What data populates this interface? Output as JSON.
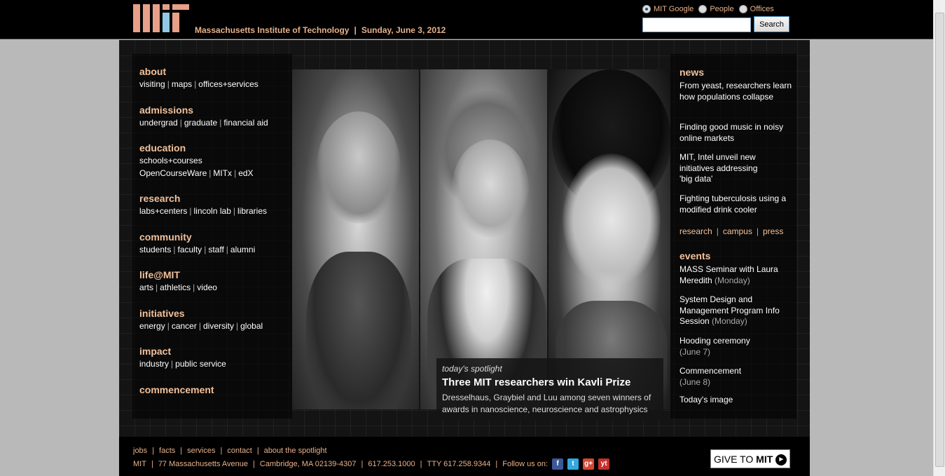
{
  "header": {
    "site_name": "Massachusetts Institute of Technology",
    "separator": "|",
    "date": "Sunday, June 3, 2012",
    "search": {
      "options": [
        "MIT Google",
        "People",
        "Offices"
      ],
      "selected": "MIT Google",
      "value": "",
      "placeholder": "",
      "button": "Search"
    }
  },
  "nav": [
    {
      "title": "about",
      "lines": [
        [
          "visiting",
          "maps",
          "offices+services"
        ]
      ]
    },
    {
      "title": "admissions",
      "lines": [
        [
          "undergrad",
          "graduate",
          "financial aid"
        ]
      ]
    },
    {
      "title": "education",
      "lines": [
        [
          "schools+courses"
        ],
        [
          "OpenCourseWare",
          "MITx",
          "edX"
        ]
      ]
    },
    {
      "title": "research",
      "lines": [
        [
          "labs+centers",
          "lincoln lab",
          "libraries"
        ]
      ]
    },
    {
      "title": "community",
      "lines": [
        [
          "students",
          "faculty",
          "staff",
          "alumni"
        ]
      ]
    },
    {
      "title": "life@MIT",
      "lines": [
        [
          "arts",
          "athletics",
          "video"
        ]
      ]
    },
    {
      "title": "initiatives",
      "lines": [
        [
          "energy",
          "cancer",
          "diversity",
          "global"
        ]
      ]
    },
    {
      "title": "impact",
      "lines": [
        [
          "industry",
          "public service"
        ]
      ]
    },
    {
      "title": "commencement",
      "lines": []
    }
  ],
  "spotlight": {
    "kicker": "today's spotlight",
    "headline": "Three MIT researchers win Kavli Prize",
    "description": "Dresselhaus, Graybiel and Luu among seven winners of awards in nanoscience, neuroscience and astrophysics"
  },
  "news": {
    "title": "news",
    "items": [
      "From yeast, researchers learn how populations collapse",
      "Finding good music in noisy online markets",
      "MIT, Intel unveil new initiatives addressing 'big data'",
      "Fighting tuberculosis using a modified drink cooler"
    ],
    "links": [
      "research",
      "campus",
      "press"
    ]
  },
  "events": {
    "title": "events",
    "items": [
      {
        "text": "MASS Seminar with Laura Meredith",
        "when": "(Monday)"
      },
      {
        "text": "System Design and Management Program Info Session",
        "when": "(Monday)"
      },
      {
        "text": "Hooding ceremony",
        "when": "(June 7)"
      },
      {
        "text": "Commencement",
        "when": "(June 8)"
      }
    ],
    "todays_image": "Today's image"
  },
  "footer": {
    "links": [
      "jobs",
      "facts",
      "services",
      "contact",
      "about the spotlight"
    ],
    "address": [
      "MIT",
      "77 Massachusetts Avenue",
      "Cambridge, MA 02139-4307",
      "617.253.1000",
      "TTY 617.258.9344"
    ],
    "follow": "Follow us on:",
    "social_icons": [
      "facebook-icon",
      "twitter-icon",
      "google-plus-icon",
      "youtube-icon"
    ],
    "give_text": "GIVE TO",
    "give_brand": "MIT"
  },
  "colors": {
    "accent": "#f2c19b",
    "topbar": "#000000",
    "page_bg": "#b9b9b9"
  }
}
